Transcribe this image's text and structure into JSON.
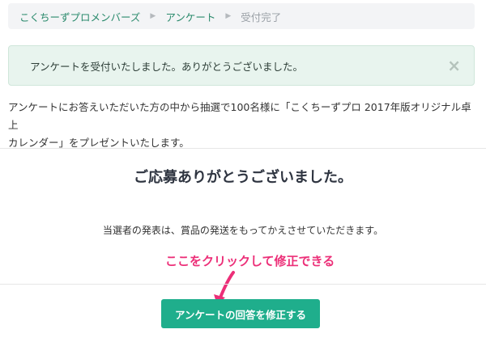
{
  "breadcrumb": {
    "items": [
      {
        "label": "こくちーずプロメンバーズ",
        "current": false
      },
      {
        "label": "アンケート",
        "current": false
      },
      {
        "label": "受付完了",
        "current": true
      }
    ]
  },
  "alert": {
    "message": "アンケートを受付いたしました。ありがとうございました。",
    "close_symbol": "×"
  },
  "intro": {
    "line1": "アンケートにお答えいただいた方の中から抽選で100名様に「こくちーずプロ 2017年版オリジナル卓上",
    "line2": "カレンダー」をプレゼントいたします。"
  },
  "thanks": {
    "heading": "ご応募ありがとうございました。",
    "notice": "当選者の発表は、賞品の発送をもってかえさせていただきます。"
  },
  "annotation": {
    "text": "ここをクリックして修正できる",
    "color": "#ec2f78"
  },
  "actions": {
    "edit_label": "アンケートの回答を修正する",
    "button_color": "#1fae8c"
  }
}
